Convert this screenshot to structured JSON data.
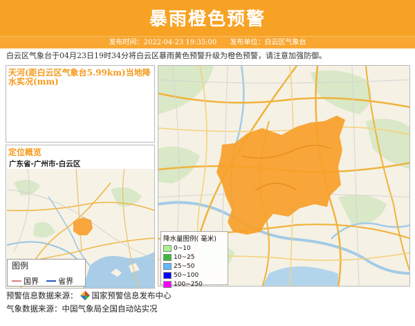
{
  "header": {
    "title": "暴雨橙色预警",
    "publish_time": "发布时间：2022-04-23 19:35:00",
    "publisher": "发布单位：白云区气象台"
  },
  "notice": "白云区气象台于04月23日19时34分将白云区暴雨黄色预警升级为橙色预警，请注意加强防御。",
  "rain_panel": {
    "title": "天河(距白云区气象台5.99km)当地降水实况(mm)"
  },
  "location_panel": {
    "title": "定位概览",
    "location": "广东省-广州市-白云区"
  },
  "mini_legend": {
    "title": "图例",
    "items": [
      {
        "label": "国界",
        "color": "#d98080"
      },
      {
        "label": "省界",
        "color": "#2255cc"
      }
    ]
  },
  "rain_legend": {
    "title": "降水量图例( 毫米)",
    "items": [
      {
        "label": "0~10",
        "color": "#a6f28f"
      },
      {
        "label": "10~25",
        "color": "#3dba3d"
      },
      {
        "label": "25~50",
        "color": "#61b8ff"
      },
      {
        "label": "50~100",
        "color": "#0000ff"
      },
      {
        "label": "100~250",
        "color": "#fa00fa"
      }
    ]
  },
  "footer": {
    "warning_source_label": "预警信息数据来源：",
    "warning_source": "国家预警信息发布中心",
    "weather_source": "气象数据来源：中国气象局全国自动站实况"
  },
  "colors": {
    "accent": "#f7a224",
    "warning_area": "#f79f2a"
  }
}
